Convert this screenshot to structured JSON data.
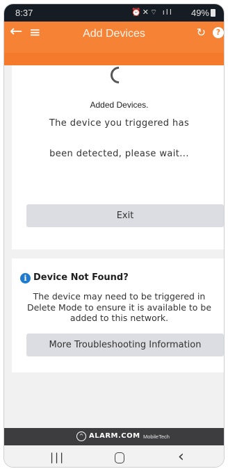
{
  "status_bar": {
    "time": "8:37",
    "icons": "⏰✕⌔ ıll",
    "battery": "49%"
  },
  "header": {
    "back_icon": "←",
    "menu_icon": "≡",
    "title": "Add Devices",
    "refresh_icon": "↻",
    "help_icon": "?",
    "color": "#f58235"
  },
  "main": {
    "added_title": "Added Devices.",
    "detect_line1": "The device you triggered has",
    "detect_line2": "been detected, please wait...",
    "exit_label": "Exit"
  },
  "not_found": {
    "info_icon": "i",
    "title": "Device Not Found?",
    "description": "The device may need to be triggered in Delete Mode to ensure it is available to be added to this network.",
    "more_label": "More Troubleshooting Information"
  },
  "brand": {
    "name": "ALARM.COM",
    "sub": "MobileTech"
  },
  "nav": {
    "recents": "|||",
    "back": "‹"
  }
}
